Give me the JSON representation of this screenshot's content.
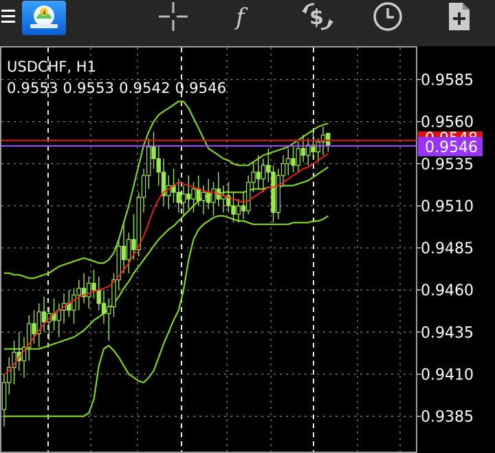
{
  "toolbar": {
    "items": [
      "menu-icon",
      "app-logo-icon",
      "crosshair-icon",
      "indicators-icon",
      "trade-icon",
      "timeframe-icon",
      "templates-icon"
    ]
  },
  "chart": {
    "symbol": "USDCHF, H1",
    "ohlc": "0.9553 0.9553 0.9542 0.9546",
    "bid_price": "0.9546",
    "ask_price_partial": "0.9548",
    "colors": {
      "background": "#000000",
      "candles": "#9be84c",
      "bollinger": "#7fd41f",
      "moving_average": "#ff1e1e",
      "bid_line": "#a64dff",
      "ask_line": "#e01010",
      "grid": "#ffffff"
    },
    "price_axis": [
      "0.9585",
      "0.9560",
      "0.9535",
      "0.9510",
      "0.9485",
      "0.9460",
      "0.9435",
      "0.9410",
      "0.9385"
    ]
  },
  "chart_data": {
    "type": "candlestick",
    "title": "USDCHF, H1",
    "y_ticks": [
      0.9585,
      0.956,
      0.9535,
      0.951,
      0.9485,
      0.946,
      0.9435,
      0.941,
      0.9385
    ],
    "ylim": [
      0.9364,
      0.9604
    ],
    "grid": true,
    "candles": [
      [
        0.9389,
        0.941,
        0.9379,
        0.9405
      ],
      [
        0.9405,
        0.942,
        0.9398,
        0.9414
      ],
      [
        0.9414,
        0.943,
        0.9404,
        0.9423
      ],
      [
        0.9423,
        0.9435,
        0.9412,
        0.9418
      ],
      [
        0.9418,
        0.9432,
        0.9408,
        0.9426
      ],
      [
        0.9426,
        0.9445,
        0.9418,
        0.944
      ],
      [
        0.944,
        0.9448,
        0.9428,
        0.9434
      ],
      [
        0.9434,
        0.9452,
        0.9426,
        0.9447
      ],
      [
        0.9447,
        0.9456,
        0.9435,
        0.9441
      ],
      [
        0.9441,
        0.945,
        0.943,
        0.9446
      ],
      [
        0.9446,
        0.9455,
        0.9436,
        0.9442
      ],
      [
        0.9442,
        0.9452,
        0.9432,
        0.9448
      ],
      [
        0.9448,
        0.9458,
        0.944,
        0.9452
      ],
      [
        0.9452,
        0.946,
        0.9444,
        0.9448
      ],
      [
        0.9448,
        0.9461,
        0.944,
        0.9457
      ],
      [
        0.9457,
        0.9466,
        0.9448,
        0.9461
      ],
      [
        0.9461,
        0.947,
        0.9452,
        0.9456
      ],
      [
        0.9456,
        0.9468,
        0.9449,
        0.9464
      ],
      [
        0.9464,
        0.9472,
        0.9455,
        0.946
      ],
      [
        0.946,
        0.9468,
        0.9448,
        0.9452
      ],
      [
        0.9452,
        0.946,
        0.944,
        0.9446
      ],
      [
        0.9446,
        0.9455,
        0.943,
        0.945
      ],
      [
        0.945,
        0.947,
        0.9444,
        0.9466
      ],
      [
        0.9466,
        0.949,
        0.946,
        0.9486
      ],
      [
        0.9486,
        0.95,
        0.947,
        0.9478
      ],
      [
        0.9478,
        0.9494,
        0.947,
        0.949
      ],
      [
        0.949,
        0.9505,
        0.9478,
        0.9484
      ],
      [
        0.9484,
        0.9518,
        0.948,
        0.9515
      ],
      [
        0.9515,
        0.9532,
        0.9506,
        0.9528
      ],
      [
        0.9528,
        0.955,
        0.952,
        0.9545
      ],
      [
        0.9545,
        0.9554,
        0.9532,
        0.9538
      ],
      [
        0.9538,
        0.9546,
        0.9522,
        0.953
      ],
      [
        0.953,
        0.9538,
        0.951,
        0.9516
      ],
      [
        0.9516,
        0.9528,
        0.9508,
        0.9522
      ],
      [
        0.9522,
        0.9532,
        0.9512,
        0.9518
      ],
      [
        0.9518,
        0.9526,
        0.9506,
        0.9512
      ],
      [
        0.9512,
        0.9522,
        0.9504,
        0.9517
      ],
      [
        0.9517,
        0.9528,
        0.9508,
        0.9514
      ],
      [
        0.9514,
        0.9524,
        0.9506,
        0.952
      ],
      [
        0.952,
        0.9528,
        0.951,
        0.9513
      ],
      [
        0.9513,
        0.9522,
        0.9505,
        0.9518
      ],
      [
        0.9518,
        0.9526,
        0.9508,
        0.9512
      ],
      [
        0.9512,
        0.9524,
        0.9504,
        0.952
      ],
      [
        0.952,
        0.953,
        0.951,
        0.9514
      ],
      [
        0.9514,
        0.9522,
        0.9506,
        0.9516
      ],
      [
        0.9516,
        0.9524,
        0.9506,
        0.951
      ],
      [
        0.951,
        0.9518,
        0.95,
        0.9505
      ],
      [
        0.9505,
        0.9514,
        0.95,
        0.951
      ],
      [
        0.951,
        0.9518,
        0.9502,
        0.9507
      ],
      [
        0.9507,
        0.9528,
        0.9505,
        0.9524
      ],
      [
        0.9524,
        0.9536,
        0.9518,
        0.953
      ],
      [
        0.953,
        0.954,
        0.952,
        0.9526
      ],
      [
        0.9526,
        0.9538,
        0.9518,
        0.9534
      ],
      [
        0.9534,
        0.9544,
        0.9524,
        0.953
      ],
      [
        0.953,
        0.9534,
        0.95,
        0.9506
      ],
      [
        0.9506,
        0.9532,
        0.9502,
        0.9528
      ],
      [
        0.9528,
        0.954,
        0.9522,
        0.9535
      ],
      [
        0.9535,
        0.9544,
        0.9528,
        0.9538
      ],
      [
        0.9538,
        0.9546,
        0.953,
        0.9534
      ],
      [
        0.9534,
        0.9548,
        0.953,
        0.9544
      ],
      [
        0.9544,
        0.9552,
        0.9536,
        0.954
      ],
      [
        0.954,
        0.955,
        0.9534,
        0.9546
      ],
      [
        0.9546,
        0.9554,
        0.9538,
        0.9542
      ],
      [
        0.9542,
        0.955,
        0.9536,
        0.9548
      ],
      [
        0.9548,
        0.9557,
        0.954,
        0.9552
      ],
      [
        0.9553,
        0.9553,
        0.9542,
        0.9546
      ]
    ],
    "moving_average": [
      0.941,
      0.9412,
      0.9416,
      0.942,
      0.9424,
      0.9428,
      0.9432,
      0.9436,
      0.944,
      0.9443,
      0.9446,
      0.9448,
      0.945,
      0.9452,
      0.9454,
      0.9456,
      0.9457,
      0.9458,
      0.9459,
      0.946,
      0.9461,
      0.9462,
      0.9465,
      0.9468,
      0.9472,
      0.9476,
      0.9481,
      0.9486,
      0.9492,
      0.95,
      0.9508,
      0.9514,
      0.9518,
      0.952,
      0.9522,
      0.9524,
      0.9523,
      0.9522,
      0.9521,
      0.952,
      0.9519,
      0.9518,
      0.9518,
      0.9517,
      0.9516,
      0.9515,
      0.9514,
      0.9513,
      0.9512,
      0.9513,
      0.9515,
      0.9517,
      0.9519,
      0.9521,
      0.9521,
      0.9522,
      0.9524,
      0.9526,
      0.9528,
      0.953,
      0.9532,
      0.9533,
      0.9535,
      0.9537,
      0.9539,
      0.9541
    ],
    "bollinger_upper": [
      0.947,
      0.947,
      0.9469,
      0.9469,
      0.9468,
      0.9467,
      0.9467,
      0.9468,
      0.9469,
      0.947,
      0.9472,
      0.9474,
      0.9475,
      0.9476,
      0.9477,
      0.9478,
      0.9479,
      0.9478,
      0.9477,
      0.9476,
      0.9476,
      0.9478,
      0.9482,
      0.949,
      0.95,
      0.951,
      0.9522,
      0.9534,
      0.9546,
      0.9554,
      0.956,
      0.9564,
      0.9566,
      0.9568,
      0.957,
      0.9572,
      0.9572,
      0.9568,
      0.9562,
      0.9556,
      0.955,
      0.9544,
      0.9542,
      0.954,
      0.9538,
      0.9537,
      0.9535,
      0.9534,
      0.9534,
      0.9534,
      0.9536,
      0.9538,
      0.954,
      0.9541,
      0.9542,
      0.9543,
      0.9544,
      0.9545,
      0.9547,
      0.9549,
      0.9551,
      0.9553,
      0.9555,
      0.9557,
      0.9558,
      0.9559
    ],
    "bollinger_middle": [
      0.9425,
      0.9425,
      0.9425,
      0.9425,
      0.9425,
      0.9425,
      0.9425,
      0.9425,
      0.9426,
      0.9427,
      0.9428,
      0.9429,
      0.943,
      0.9431,
      0.9432,
      0.9434,
      0.9436,
      0.9439,
      0.9442,
      0.9444,
      0.9446,
      0.9449,
      0.9452,
      0.9456,
      0.9461,
      0.9465,
      0.947,
      0.9474,
      0.9478,
      0.9482,
      0.9486,
      0.949,
      0.9493,
      0.9496,
      0.9498,
      0.9501,
      0.9504,
      0.9507,
      0.951,
      0.9513,
      0.9515,
      0.9516,
      0.9517,
      0.9517,
      0.9518,
      0.9518,
      0.9518,
      0.9518,
      0.9518,
      0.9519,
      0.952,
      0.952,
      0.952,
      0.9521,
      0.9521,
      0.9521,
      0.9522,
      0.9522,
      0.9522,
      0.9523,
      0.9524,
      0.9525,
      0.9527,
      0.9529,
      0.9531,
      0.9533
    ],
    "bollinger_lower": [
      0.9385,
      0.9385,
      0.9385,
      0.9385,
      0.9385,
      0.9385,
      0.9385,
      0.9385,
      0.9385,
      0.9385,
      0.9385,
      0.9385,
      0.9385,
      0.9385,
      0.9385,
      0.9385,
      0.9385,
      0.9387,
      0.9395,
      0.9415,
      0.9425,
      0.9427,
      0.9424,
      0.942,
      0.9415,
      0.941,
      0.9408,
      0.9406,
      0.9405,
      0.9408,
      0.9412,
      0.942,
      0.9428,
      0.9435,
      0.9442,
      0.9448,
      0.946,
      0.9478,
      0.949,
      0.9496,
      0.9499,
      0.9501,
      0.9503,
      0.9504,
      0.9504,
      0.9503,
      0.9502,
      0.9501,
      0.9501,
      0.95,
      0.9499,
      0.9499,
      0.9499,
      0.9499,
      0.9499,
      0.9499,
      0.9499,
      0.9499,
      0.95,
      0.95,
      0.95,
      0.95,
      0.9501,
      0.9501,
      0.9502,
      0.9504
    ]
  }
}
